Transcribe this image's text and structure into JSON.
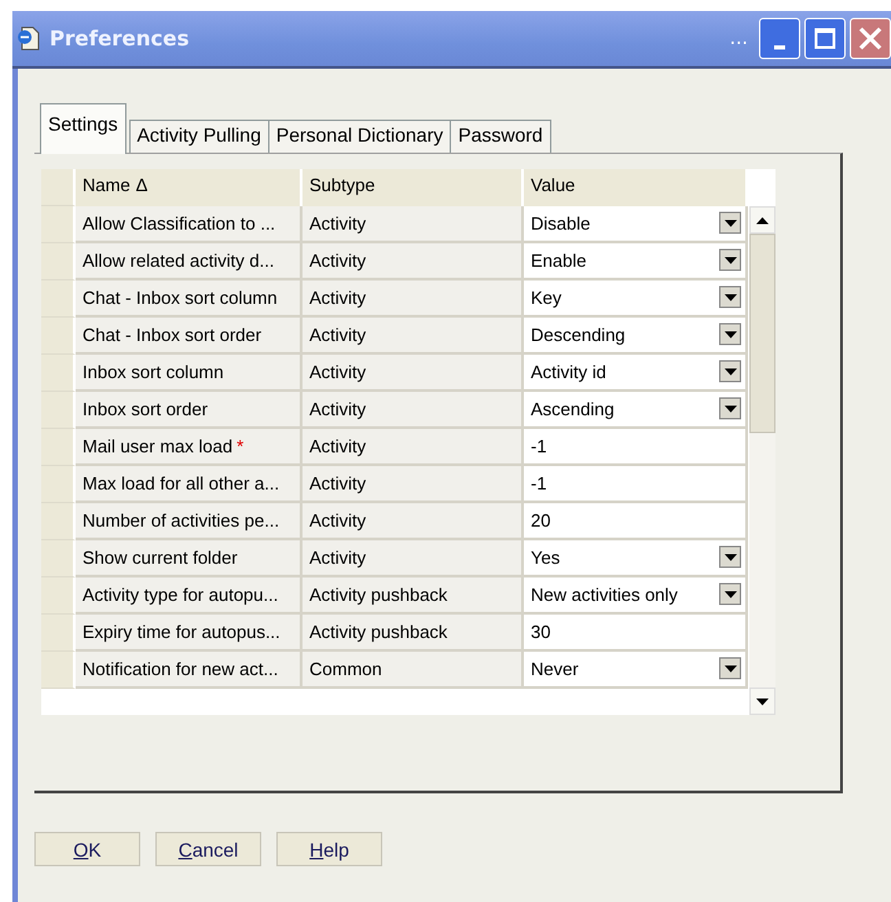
{
  "window": {
    "title": "Preferences",
    "overflow": "..."
  },
  "tabs": [
    {
      "label": "Settings",
      "selected": true
    },
    {
      "label": "Activity Pulling",
      "selected": false
    },
    {
      "label": "Personal Dictionary",
      "selected": false
    },
    {
      "label": "Password",
      "selected": false
    }
  ],
  "table": {
    "columns": [
      {
        "label": "Name",
        "sort_mark": "Δ"
      },
      {
        "label": "Subtype"
      },
      {
        "label": "Value"
      }
    ],
    "rows": [
      {
        "name": "Allow Classification to ...",
        "subtype": "Activity",
        "value": "Disable",
        "kind": "dropdown"
      },
      {
        "name": "Allow related activity d...",
        "subtype": "Activity",
        "value": "Enable",
        "kind": "dropdown"
      },
      {
        "name": "Chat - Inbox sort column",
        "subtype": "Activity",
        "value": "Key",
        "kind": "dropdown"
      },
      {
        "name": "Chat - Inbox sort order",
        "subtype": "Activity",
        "value": "Descending",
        "kind": "dropdown"
      },
      {
        "name": "Inbox sort column",
        "subtype": "Activity",
        "value": "Activity id",
        "kind": "dropdown"
      },
      {
        "name": "Inbox sort order",
        "subtype": "Activity",
        "value": "Ascending",
        "kind": "dropdown"
      },
      {
        "name": "Mail user max load",
        "required_mark": "*",
        "subtype": "Activity",
        "value": "-1",
        "kind": "text"
      },
      {
        "name": "Max load for all other a...",
        "subtype": "Activity",
        "value": "-1",
        "kind": "text"
      },
      {
        "name": "Number of activities pe...",
        "subtype": "Activity",
        "value": "20",
        "kind": "text"
      },
      {
        "name": "Show current folder",
        "subtype": "Activity",
        "value": "Yes",
        "kind": "dropdown"
      },
      {
        "name": "Activity type for autopu...",
        "subtype": "Activity pushback",
        "value": "New activities only",
        "kind": "dropdown"
      },
      {
        "name": "Expiry time for autopus...",
        "subtype": "Activity pushback",
        "value": "30",
        "kind": "text"
      },
      {
        "name": "Notification for new act...",
        "subtype": "Common",
        "value": "Never",
        "kind": "dropdown"
      }
    ]
  },
  "buttons": [
    {
      "accel": "O",
      "rest": "K"
    },
    {
      "accel": "C",
      "rest": "ancel"
    },
    {
      "accel": "H",
      "rest": "elp"
    }
  ]
}
